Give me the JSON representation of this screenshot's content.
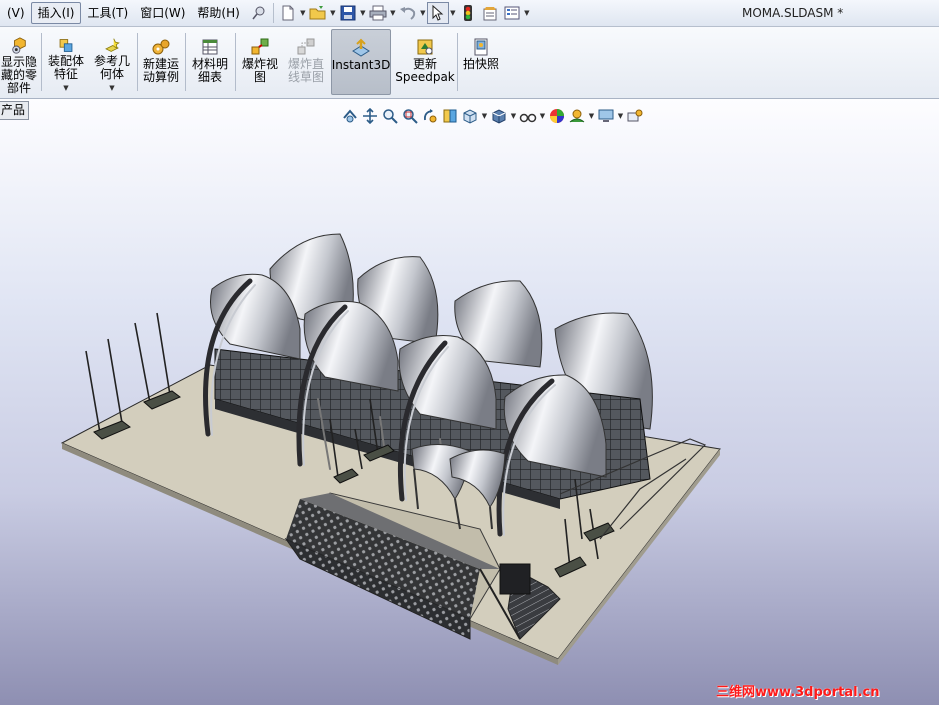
{
  "menubar": {
    "items": [
      {
        "label": "(V)",
        "active": false
      },
      {
        "label": "插入(I)",
        "active": true
      },
      {
        "label": "工具(T)",
        "active": false
      },
      {
        "label": "窗口(W)",
        "active": false
      },
      {
        "label": "帮助(H)",
        "active": false
      }
    ]
  },
  "document": {
    "title": "MOMA.SLDASM *"
  },
  "commands": [
    {
      "label": "显示隐\n藏的零\n部件",
      "icon": "show-hidden-components-icon",
      "dropdown": false,
      "disabled": false,
      "pressed": false
    },
    {
      "label": "装配体\n特征",
      "icon": "assembly-features-icon",
      "dropdown": true,
      "disabled": false,
      "pressed": false
    },
    {
      "label": "参考几\n何体",
      "icon": "reference-geometry-icon",
      "dropdown": true,
      "disabled": false,
      "pressed": false
    },
    {
      "label": "新建运\n动算例",
      "icon": "new-motion-study-icon",
      "dropdown": false,
      "disabled": false,
      "pressed": false
    },
    {
      "label": "材料明\n细表",
      "icon": "bill-of-materials-icon",
      "dropdown": false,
      "disabled": false,
      "pressed": false
    },
    {
      "label": "爆炸视\n图",
      "icon": "exploded-view-icon",
      "dropdown": false,
      "disabled": false,
      "pressed": false
    },
    {
      "label": "爆炸直\n线草图",
      "icon": "explode-line-sketch-icon",
      "dropdown": false,
      "disabled": true,
      "pressed": false
    },
    {
      "label": "Instant3D",
      "icon": "instant3d-icon",
      "dropdown": false,
      "disabled": false,
      "pressed": true
    },
    {
      "label": "更新\nSpeedpak",
      "icon": "update-speedpak-icon",
      "dropdown": false,
      "disabled": false,
      "pressed": false
    },
    {
      "label": "拍快照",
      "icon": "take-snapshot-icon",
      "dropdown": false,
      "disabled": false,
      "pressed": false
    }
  ],
  "viewport": {
    "tab_label": "产品"
  },
  "watermark": {
    "text": "三维网www.3dportal.cn",
    "color": "#ff1a1a"
  },
  "colors": {
    "accent": "#ff1a1a",
    "menubar": "#dfe6f1",
    "viewport_top": "#fdfdff",
    "viewport_bottom": "#8e8fb2"
  }
}
